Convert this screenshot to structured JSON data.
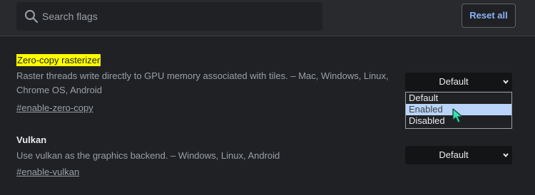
{
  "search": {
    "placeholder": "Search flags",
    "icon": "search-icon"
  },
  "header": {
    "reset_label": "Reset all"
  },
  "colors": {
    "accent": "#8ab4f8",
    "highlight": "#ffff00",
    "background": "#202124",
    "hover": "#b9d4f8"
  },
  "flags": [
    {
      "title": "Zero-copy rasterizer",
      "description_line1": "Raster threads write directly to GPU memory associated with tiles. – Mac, Windows, Linux,",
      "description_line2": "Chrome OS, Android",
      "link": "#enable-zero-copy",
      "selected": "Default",
      "options": [
        "Default",
        "Enabled",
        "Disabled"
      ],
      "hovered_option": "Enabled"
    },
    {
      "title": "Vulkan",
      "description": "Use vulkan as the graphics backend. – Windows, Linux, Android",
      "link": "#enable-vulkan",
      "selected": "Default"
    }
  ]
}
